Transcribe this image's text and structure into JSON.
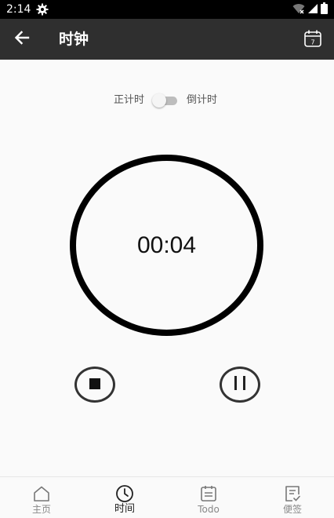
{
  "status_bar": {
    "time": "2:14",
    "icons": [
      "settings-icon",
      "wifi-off-icon",
      "cellular-icon",
      "battery-icon"
    ]
  },
  "app_bar": {
    "title": "时钟",
    "back_icon": "arrow-left-icon",
    "calendar_icon": "calendar-icon",
    "calendar_day": "7"
  },
  "mode_toggle": {
    "left_label": "正计时",
    "right_label": "倒计时",
    "checked": false
  },
  "timer": {
    "display": "00:04"
  },
  "controls": {
    "stop_icon": "stop-icon",
    "pause_icon": "pause-icon"
  },
  "bottom_nav": {
    "items": [
      {
        "label": "主页",
        "icon": "home-icon",
        "active": false
      },
      {
        "label": "时间",
        "icon": "clock-icon",
        "active": true
      },
      {
        "label": "Todo",
        "icon": "todo-icon",
        "active": false
      },
      {
        "label": "便签",
        "icon": "note-icon",
        "active": false
      }
    ]
  },
  "colors": {
    "app_bar": "#2f2f2f",
    "status_bar": "#000000",
    "background": "#fafafa",
    "ring": "#000000"
  }
}
